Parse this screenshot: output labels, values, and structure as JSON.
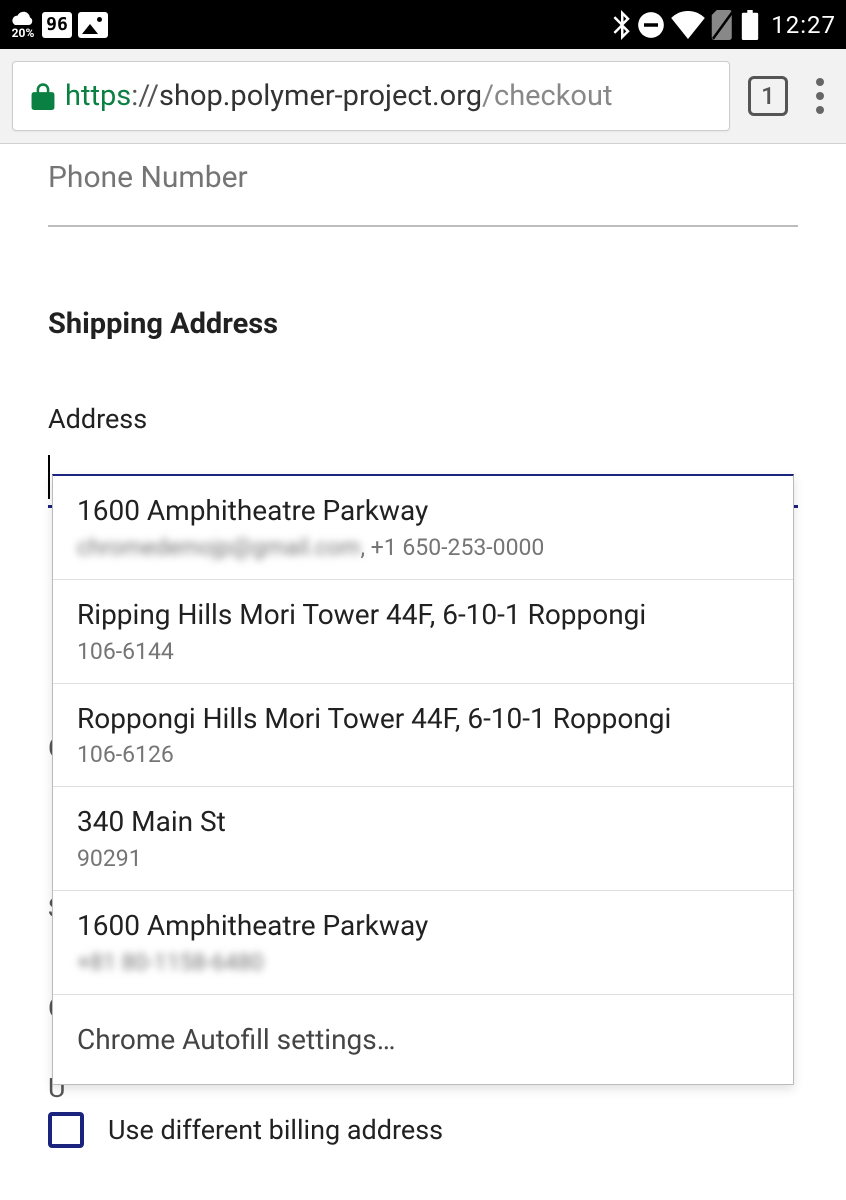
{
  "status_bar": {
    "cloud_percent": "20%",
    "square_badge": "96",
    "time": "12:27"
  },
  "browser": {
    "scheme": "https",
    "separator": "://",
    "host": "shop.polymer-project.org",
    "path": "/checkout",
    "tab_count": "1"
  },
  "form": {
    "phone_placeholder": "Phone Number",
    "section_title": "Shipping Address",
    "address_label": "Address",
    "address_value": "",
    "billing_checkbox_label": "Use different billing address",
    "billing_checked": false
  },
  "hidden_fields": {
    "c1": "C",
    "c2": "S",
    "c3": "C",
    "c4": "U"
  },
  "autofill": {
    "items": [
      {
        "primary": "1600 Amphitheatre Parkway",
        "secondary_blur": "chromedemojp@gmail.com",
        "secondary_plain": ", +1 650-253-0000"
      },
      {
        "primary": "Ripping Hills Mori Tower 44F, 6-10-1 Roppongi",
        "secondary_blur": "",
        "secondary_plain": "106-6144"
      },
      {
        "primary": "Roppongi Hills Mori Tower 44F, 6-10-1 Roppongi",
        "secondary_blur": "",
        "secondary_plain": "106-6126"
      },
      {
        "primary": "340 Main St",
        "secondary_blur": "",
        "secondary_plain": "90291"
      },
      {
        "primary": "1600 Amphitheatre Parkway",
        "secondary_blur": "+81 80-1158-6480",
        "secondary_plain": ""
      }
    ],
    "settings_label": "Chrome Autofill settings…"
  }
}
